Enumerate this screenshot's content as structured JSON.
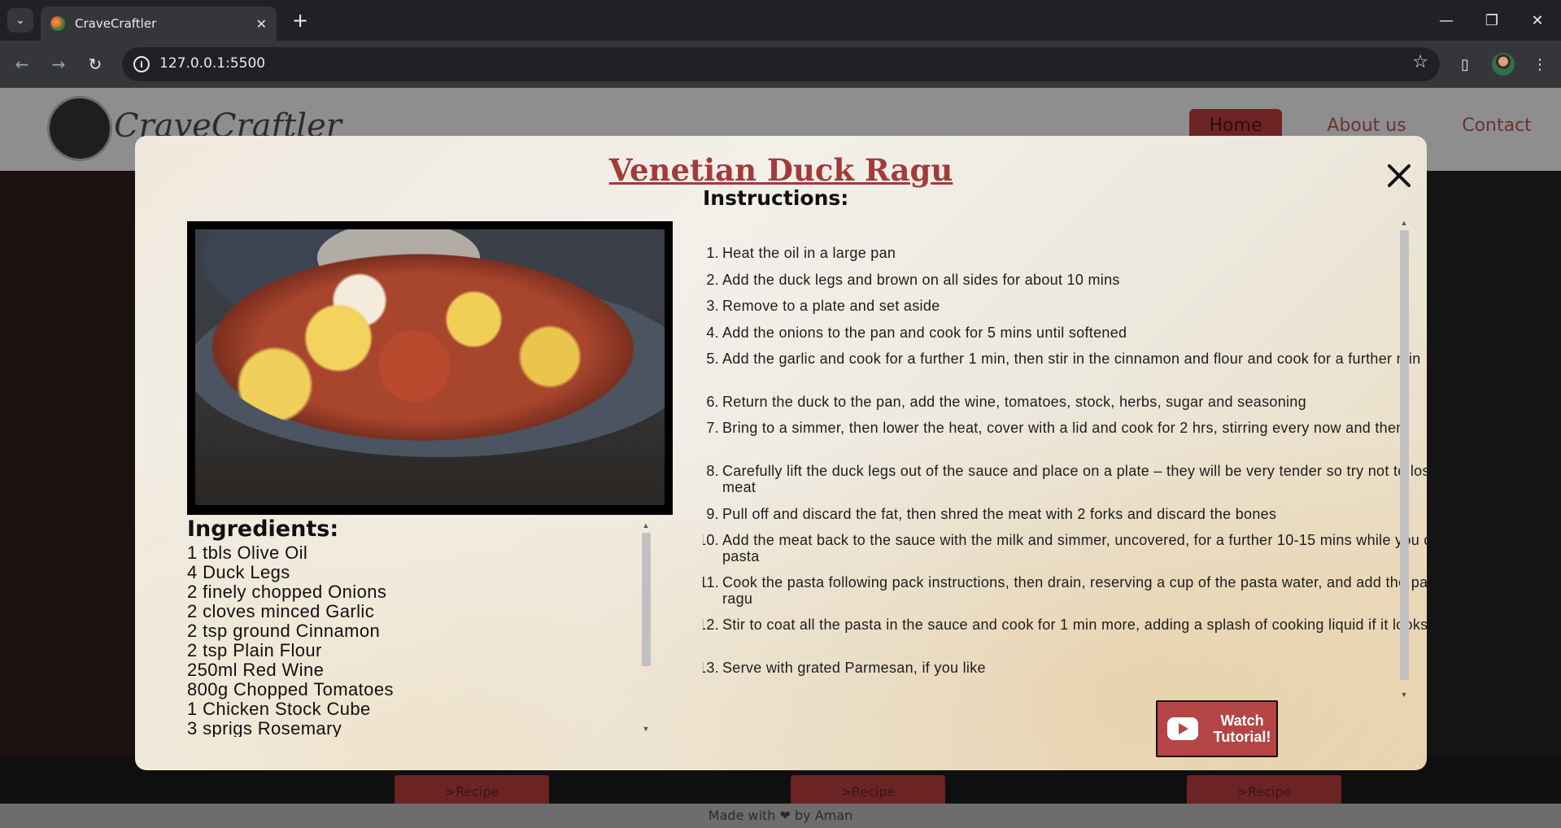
{
  "browser": {
    "tab_title": "CraveCraftler",
    "url": "127.0.0.1:5500"
  },
  "site": {
    "brand": "CraveCraftler",
    "nav": [
      "Home",
      "About us",
      "Contact"
    ],
    "recipe_button": ">Recipe",
    "footer": "Made with ❤ by Aman"
  },
  "modal": {
    "title": "Venetian Duck Ragu",
    "instructions_heading": "Instructions:",
    "instructions": [
      "Heat the oil in a large pan",
      "Add the duck legs and brown on all sides for about 10 mins",
      "Remove to a plate and set aside",
      "Add the onions to the pan and cook for 5 mins until softened",
      "Add the garlic and cook for a further 1 min, then stir in the cinnamon and flour and cook for a further min",
      "Return the duck to the pan, add the wine, tomatoes, stock, herbs, sugar and seasoning",
      "Bring to a simmer, then lower the heat, cover with a lid and cook for 2 hrs, stirring every now and then",
      "Carefully lift the duck legs out of the sauce and place on a plate – they will be very tender so try not to lose any of the meat",
      "Pull off and discard the fat, then shred the meat with 2 forks and discard the bones",
      "Add the meat back to the sauce with the milk and simmer, uncovered, for a further 10-15 mins while you cook the pasta",
      "Cook the pasta following pack instructions, then drain, reserving a cup of the pasta water, and add the pasta to the ragu",
      "Stir to coat all the pasta in the sauce and cook for 1 min more, adding a splash of cooking liquid if it looks dry",
      "Serve with grated Parmesan, if you like"
    ],
    "ingredients_heading": "Ingredients:",
    "ingredients": [
      "1 tbls Olive Oil",
      "4 Duck Legs",
      "2 finely chopped Onions",
      "2 cloves minced Garlic",
      "2 tsp ground Cinnamon",
      "2 tsp Plain Flour",
      "250ml Red Wine",
      "800g Chopped Tomatoes",
      "1 Chicken Stock Cube",
      "3 sprigs Rosemary"
    ],
    "watch_button": "Watch Tutorial!",
    "image_alt": "Duck ragu pasta"
  },
  "icons": {
    "youtube": "youtube-icon",
    "close": "close-icon"
  },
  "colors": {
    "accent": "#b54545",
    "title": "#a33b3b"
  }
}
